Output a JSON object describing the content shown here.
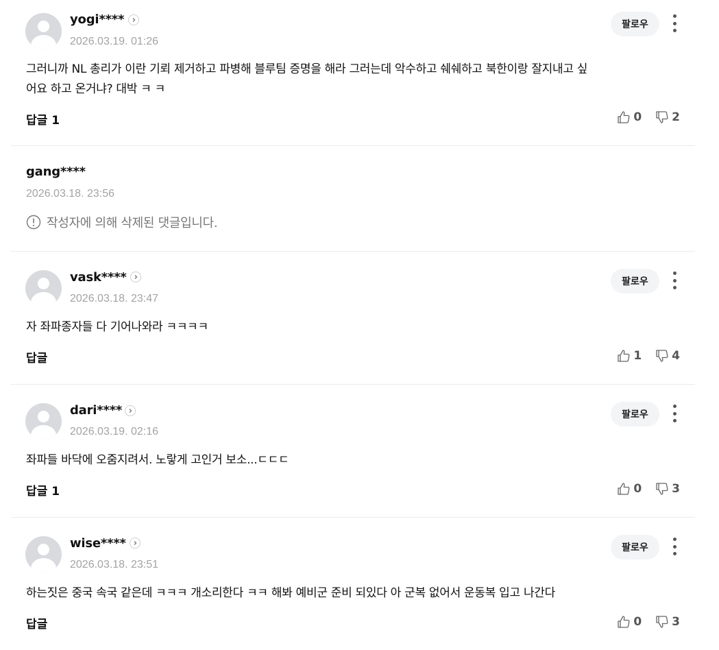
{
  "follow_label": "팔로우",
  "reply_label": "답글",
  "comments": [
    {
      "nickname": "yogi****",
      "date": "2026.03.19. 01:26",
      "text_line1": "그러니까 NL 총리가 이란 기뢰 제거하고 파병해 블루팀 증명을 해라 그러는데 악수하고 쉐쉐하고 북한이랑 잘지내고 싶",
      "text_line2": "어요 하고 온거냐? 대박 ㅋ ㅋ",
      "reply_count": "1",
      "likes": "0",
      "dislikes": "2"
    },
    {
      "nickname": "gang****",
      "date": "2026.03.18. 23:56",
      "deleted_text": "작성자에 의해 삭제된 댓글입니다."
    },
    {
      "nickname": "vask****",
      "date": "2026.03.18. 23:47",
      "text": "자 좌파종자들 다 기어나와라 ㅋㅋㅋㅋ",
      "reply_count": "",
      "likes": "1",
      "dislikes": "4"
    },
    {
      "nickname": "dari****",
      "date": "2026.03.19. 02:16",
      "text": "좌파들 바닥에 오줌지려서. 노랗게 고인거 보소...ㄷㄷㄷ",
      "reply_count": "1",
      "likes": "0",
      "dislikes": "3"
    },
    {
      "nickname": "wise****",
      "date": "2026.03.18. 23:51",
      "text": "하는짓은 중국 속국 같은데 ㅋㅋㅋ 개소리한다 ㅋㅋ 해봐 예비군 준비 되있다 아 군복 없어서 운동복 입고 나간다",
      "reply_count": "",
      "likes": "0",
      "dislikes": "3"
    }
  ]
}
